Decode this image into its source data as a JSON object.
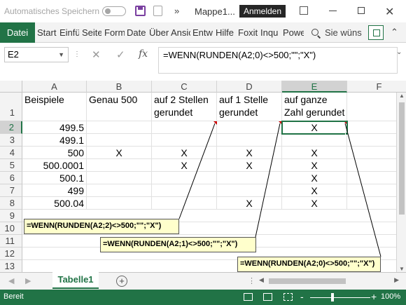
{
  "titlebar": {
    "autosave": "Automatisches Speichern",
    "more": "»",
    "doc_title": "Mappe1...",
    "signin": "Anmelden",
    "close": "✕"
  },
  "ribbon": {
    "file": "Datei",
    "tabs": [
      "Start",
      "Einfü",
      "Seite",
      "Form",
      "Date",
      "Über",
      "Ansic",
      "Entw",
      "Hilfe",
      "Foxit",
      "Inqu",
      "Powe"
    ],
    "search": "Sie wüns",
    "collapse": "⌃"
  },
  "formula_bar": {
    "name_box": "E2",
    "name_box_arrow": "▼",
    "dots": "⋮",
    "cancel": "✕",
    "enter": "✓",
    "fx": "fx",
    "formula": "=WENN(RUNDEN(A2;0)<>500;\"\";\"X\")",
    "expand": "⌄"
  },
  "grid": {
    "columns": [
      "A",
      "B",
      "C",
      "D",
      "E",
      "F"
    ],
    "rows": [
      "1",
      "2",
      "3",
      "4",
      "5",
      "6",
      "7",
      "8",
      "9",
      "10",
      "11",
      "12",
      "13"
    ],
    "headers": {
      "A": "Beispiele",
      "B": "Genau 500",
      "C1": "auf 2 Stellen",
      "C2": "gerundet",
      "D1": "auf 1 Stelle",
      "D2": "gerundet",
      "E1": "auf ganze",
      "E2": "Zahl gerundet"
    },
    "A": [
      "499.5",
      "499.1",
      "500",
      "500.0001",
      "500.1",
      "499",
      "500.04"
    ],
    "B": [
      "",
      "",
      "X",
      "",
      "",
      "",
      ""
    ],
    "C": [
      "",
      "",
      "X",
      "X",
      "",
      "",
      ""
    ],
    "D": [
      "",
      "",
      "X",
      "X",
      "",
      "",
      "X"
    ],
    "E": [
      "X",
      "",
      "X",
      "X",
      "X",
      "X",
      "X"
    ],
    "selected_cell": "E2"
  },
  "callouts": [
    "=WENN(RUNDEN(A2;2)<>500;\"\";\"X\")",
    "=WENN(RUNDEN(A2;1)<>500;\"\";\"X\")",
    "=WENN(RUNDEN(A2;0)<>500;\"\";\"X\")"
  ],
  "sheets": {
    "nav_prev": "◀",
    "nav_next": "▶",
    "active": "Tabelle1",
    "add": "+",
    "dots": "⋮",
    "scroll_left": "◀",
    "scroll_right": "▶"
  },
  "vscroll": {
    "up": "▲",
    "down": "▼"
  },
  "status": {
    "ready": "Bereit",
    "zoom_minus": "-",
    "zoom_plus": "+",
    "zoom": "100%"
  },
  "colors": {
    "excel_green": "#217346",
    "callout_bg": "#ffffcc",
    "comment_marker": "#cc0000"
  }
}
